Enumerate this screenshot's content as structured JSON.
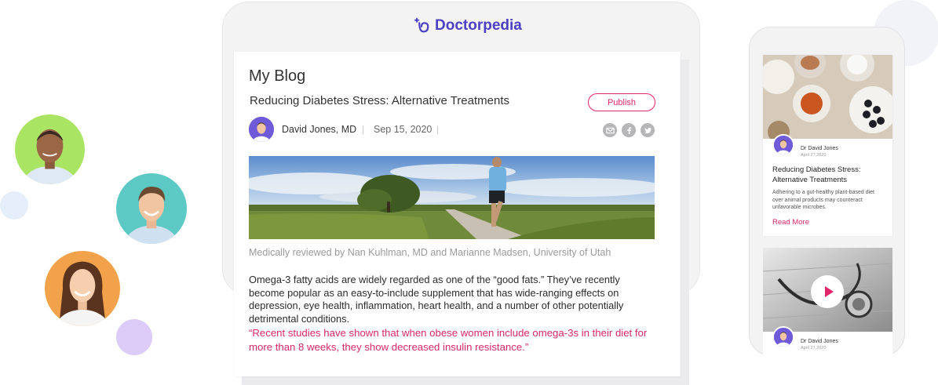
{
  "brand": {
    "name": "Doctorpedia",
    "accent": "#4b3fc4",
    "pink": "#e0266a"
  },
  "blog": {
    "heading": "My Blog",
    "post_title": "Reducing Diabetes Stress:  Alternative Treatments",
    "publish_label": "Publish",
    "author": "David Jones, MD",
    "date": "Sep 15, 2020",
    "separator": "|",
    "share_icons": [
      "mail-icon",
      "facebook-icon",
      "twitter-icon"
    ],
    "reviewed_by": "Medically reviewed by Nan Kuhlman, MD and Marianne Madsen, University of Utah",
    "body": "Omega-3 fatty acids are widely regarded as one of the “good fats.” They’ve recently become popular as an easy-to-include supplement that has wide-ranging effects on depression, eye health, inflammation, heart health, and a number of other potentially detrimental conditions.",
    "quote": "“Recent studies have shown that when obese women include omega-3s in their diet for more than 8 weeks, they show decreased insulin resistance.”"
  },
  "mobile": {
    "card1": {
      "author": "Dr David Jones",
      "date": "April 27,2020",
      "title": "Reducing Diabetes Stress: Alternative Treatments",
      "excerpt": "Adhering to a gut-healthy plant-based diet over animal products may counteract unfavorable microbes.",
      "read_more": "Read More"
    },
    "card2": {
      "author": "Dr David Jones",
      "date": "April 27,2020"
    }
  }
}
